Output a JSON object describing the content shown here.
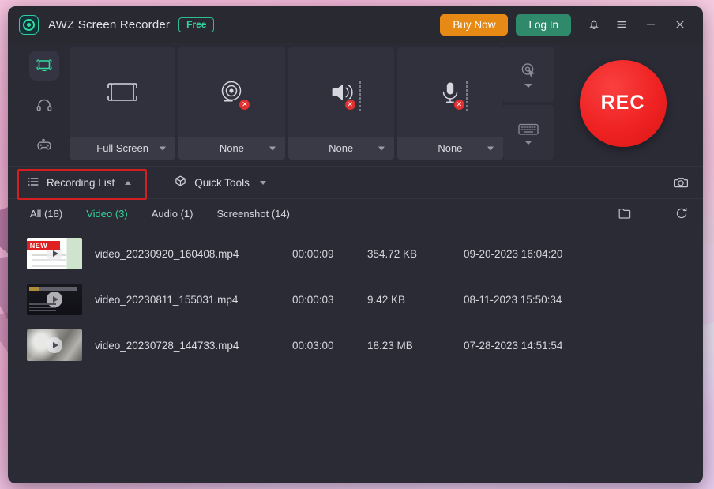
{
  "window": {
    "app_title": "AWZ Screen Recorder",
    "plan_badge": "Free",
    "buy_now_label": "Buy Now",
    "log_in_label": "Log In",
    "icons": {
      "logo": "app-logo-icon",
      "bell": "notification-bell-icon",
      "menu": "hamburger-menu-icon",
      "minimize": "minimize-icon",
      "close": "close-icon"
    },
    "accent_colors": {
      "brand_green": "#2fd79b",
      "buy_now_orange": "#e78a15",
      "log_in_green": "#2f8a6b",
      "rec_red": "#ef2222",
      "highlight_red": "#d31f1f",
      "window_bg": "#2b2b36",
      "tile_bg": "#31313d",
      "tile_footer_bg": "#3a3a47"
    }
  },
  "sidebar": {
    "items": [
      {
        "name": "screen-recorder",
        "icon": "monitor-icon",
        "active": true
      },
      {
        "name": "audio-recorder",
        "icon": "headphones-icon",
        "active": false
      },
      {
        "name": "game-recorder",
        "icon": "gamepad-icon",
        "active": false
      }
    ]
  },
  "capture": {
    "tiles": [
      {
        "id": "screen",
        "icon": "fullscreen-frame-icon",
        "label": "Full Screen",
        "disabled": false
      },
      {
        "id": "webcam",
        "icon": "webcam-icon",
        "label": "None",
        "disabled": true
      },
      {
        "id": "speaker",
        "icon": "speaker-icon",
        "label": "None",
        "disabled": true
      },
      {
        "id": "microphone",
        "icon": "microphone-icon",
        "label": "None",
        "disabled": true
      }
    ],
    "mini_tiles": [
      {
        "id": "mouse-click",
        "icon": "cursor-click-icon"
      },
      {
        "id": "keystroke",
        "icon": "keyboard-icon"
      }
    ],
    "rec_label": "REC"
  },
  "tabbar": {
    "recording_list_label": "Recording List",
    "recording_list_icon": "list-icon",
    "recording_list_expanded": true,
    "quick_tools_label": "Quick Tools",
    "quick_tools_icon": "cube-icon",
    "screenshot_icon": "camera-icon",
    "highlighted": "recording-list"
  },
  "filters": {
    "tabs": [
      {
        "label": "All (18)",
        "active": false
      },
      {
        "label": "Video (3)",
        "active": true
      },
      {
        "label": "Audio (1)",
        "active": false
      },
      {
        "label": "Screenshot (14)",
        "active": false
      }
    ],
    "folder_icon": "folder-icon",
    "refresh_icon": "refresh-icon"
  },
  "file_list": {
    "rows": [
      {
        "name": "video_20230920_160408.mp4",
        "duration": "00:00:09",
        "size": "354.72 KB",
        "date": "09-20-2023 16:04:20",
        "badge": "NEW",
        "thumb_style": "thumb-doc"
      },
      {
        "name": "video_20230811_155031.mp4",
        "duration": "00:00:03",
        "size": "9.42 KB",
        "date": "08-11-2023 15:50:34",
        "badge": "",
        "thumb_style": "thumb-dark"
      },
      {
        "name": "video_20230728_144733.mp4",
        "duration": "00:03:00",
        "size": "18.23 MB",
        "date": "07-28-2023 14:51:54",
        "badge": "",
        "thumb_style": "thumb-photo"
      }
    ]
  }
}
